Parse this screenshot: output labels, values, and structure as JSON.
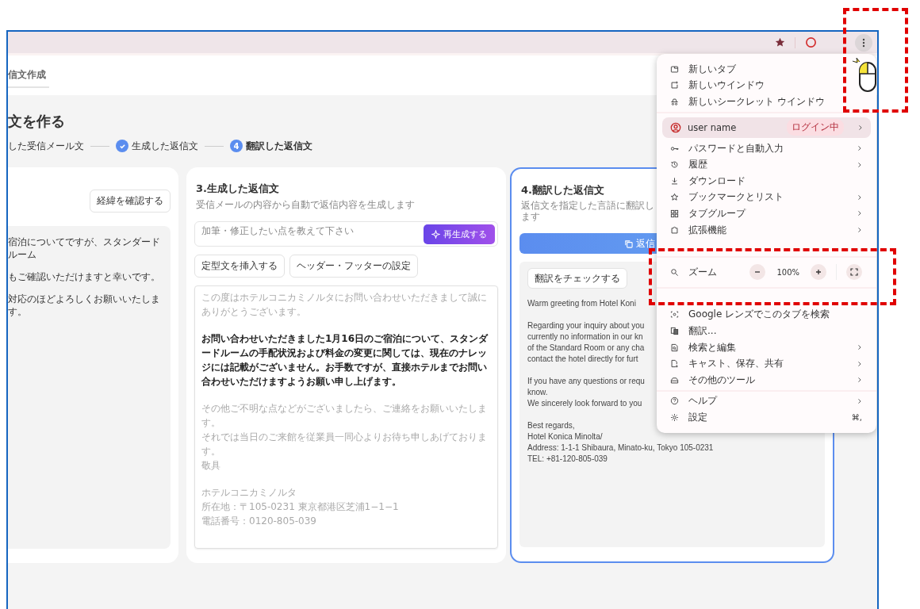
{
  "header": {
    "tab": "信文作成"
  },
  "page_title": "文を作る",
  "steps": [
    {
      "label": "した受信メール文",
      "done": false,
      "selected": false
    },
    {
      "label": "生成した返信文",
      "done": true,
      "selected": false
    },
    {
      "label": "翻訳した返信文",
      "done": false,
      "selected": true,
      "number": "4"
    }
  ],
  "card_1": {
    "button": "経緯を確認する",
    "lines": [
      "宿泊についてですが、スタンダードルーム",
      "もご確認いただけますと幸いです。",
      "対応のほどよろしくお願いいたします。"
    ]
  },
  "card_2": {
    "title": "3.生成した返信文",
    "subtitle": "受信メールの内容から自動で返信内容を生成します",
    "input": {
      "placeholder": "加筆・修正したい点を教えて下さい"
    },
    "regenerate_button": "再生成する",
    "buttons": [
      "定型文を挿入する",
      "ヘッダー・フッターの設定"
    ],
    "paragraphs": [
      {
        "kind": "template",
        "lines": [
          "この度はホテルコニカミノルタにお問い合わせいただきまして誠にありがとうございます。"
        ]
      },
      {
        "kind": "generated",
        "lines": [
          "お問い合わせいただきました1月16日のご宿泊について、スタンダードルームの手配状況および料金の変更に関しては、現在のナレッジには記載がございません。お手数ですが、直接ホテルまでお問い合わせいただけますようお願い申し上げます。"
        ]
      },
      {
        "kind": "template",
        "lines": [
          "その他ご不明な点などがございましたら、ご連絡をお願いいたします。",
          "それでは当日のご来館を従業員一同心よりお待ち申しあげております。",
          "敬具"
        ]
      },
      {
        "kind": "template",
        "lines": [
          "ホテルコニカミノルタ",
          "所在地：〒105-0231 東京都港区芝浦1−1−1",
          "電話番号：0120-805-039"
        ]
      }
    ]
  },
  "card_3": {
    "title": "4.翻訳した返信文",
    "subtitle": "返信文を指定した言語に翻訳します",
    "copy_button": "返信",
    "check_button": "翻訳をチェックする",
    "selected": true,
    "paragraphs": [
      [
        "Warm greeting from Hotel Koni"
      ],
      [
        "Regarding your inquiry about you",
        "currently no information in our kn",
        "of the Standard Room or any cha",
        "contact the hotel directly for furt"
      ],
      [
        "If you have any questions or requ",
        "know.",
        "We sincerely look forward to you"
      ],
      [
        "Best regards,",
        "Hotel Konica Minolta/",
        "Address: 1-1-1 Shibaura, Minato-ku, Tokyo 105-0231",
        "TEL: +81-120-805-039"
      ]
    ]
  },
  "menu": {
    "sections": [
      [
        {
          "kind": "item",
          "label": "新しいタブ",
          "submenu": false
        },
        {
          "kind": "item",
          "label": "新しいウインドウ",
          "submenu": false
        },
        {
          "kind": "item",
          "label": "新しいシークレット ウインドウ",
          "submenu": false
        }
      ],
      [
        {
          "kind": "profile",
          "label": "user name",
          "badge": "ログイン中",
          "submenu": true
        },
        {
          "kind": "item",
          "label": "パスワードと自動入力",
          "submenu": true
        },
        {
          "kind": "item",
          "label": "履歴",
          "submenu": true
        },
        {
          "kind": "item",
          "label": "ダウンロード",
          "submenu": false
        },
        {
          "kind": "item",
          "label": "ブックマークとリスト",
          "submenu": true
        },
        {
          "kind": "item",
          "label": "タブグループ",
          "submenu": true
        },
        {
          "kind": "item",
          "label": "拡張機能",
          "submenu": true
        },
        {
          "kind": "covered"
        }
      ],
      [
        {
          "kind": "zoom",
          "label": "ズーム",
          "value": "100%"
        }
      ],
      [
        {
          "kind": "covered"
        },
        {
          "kind": "item",
          "label": "Google レンズでこのタブを検索",
          "submenu": false
        },
        {
          "kind": "item",
          "label": "翻訳...",
          "submenu": false
        },
        {
          "kind": "item",
          "label": "検索と編集",
          "submenu": true
        },
        {
          "kind": "item",
          "label": "キャスト、保存、共有",
          "submenu": true
        },
        {
          "kind": "item",
          "label": "その他のツール",
          "submenu": true
        }
      ],
      [
        {
          "kind": "item",
          "label": "ヘルプ",
          "submenu": true
        },
        {
          "kind": "item",
          "label": "設定",
          "submenu": false,
          "shortcut": "⌘,"
        }
      ]
    ]
  }
}
